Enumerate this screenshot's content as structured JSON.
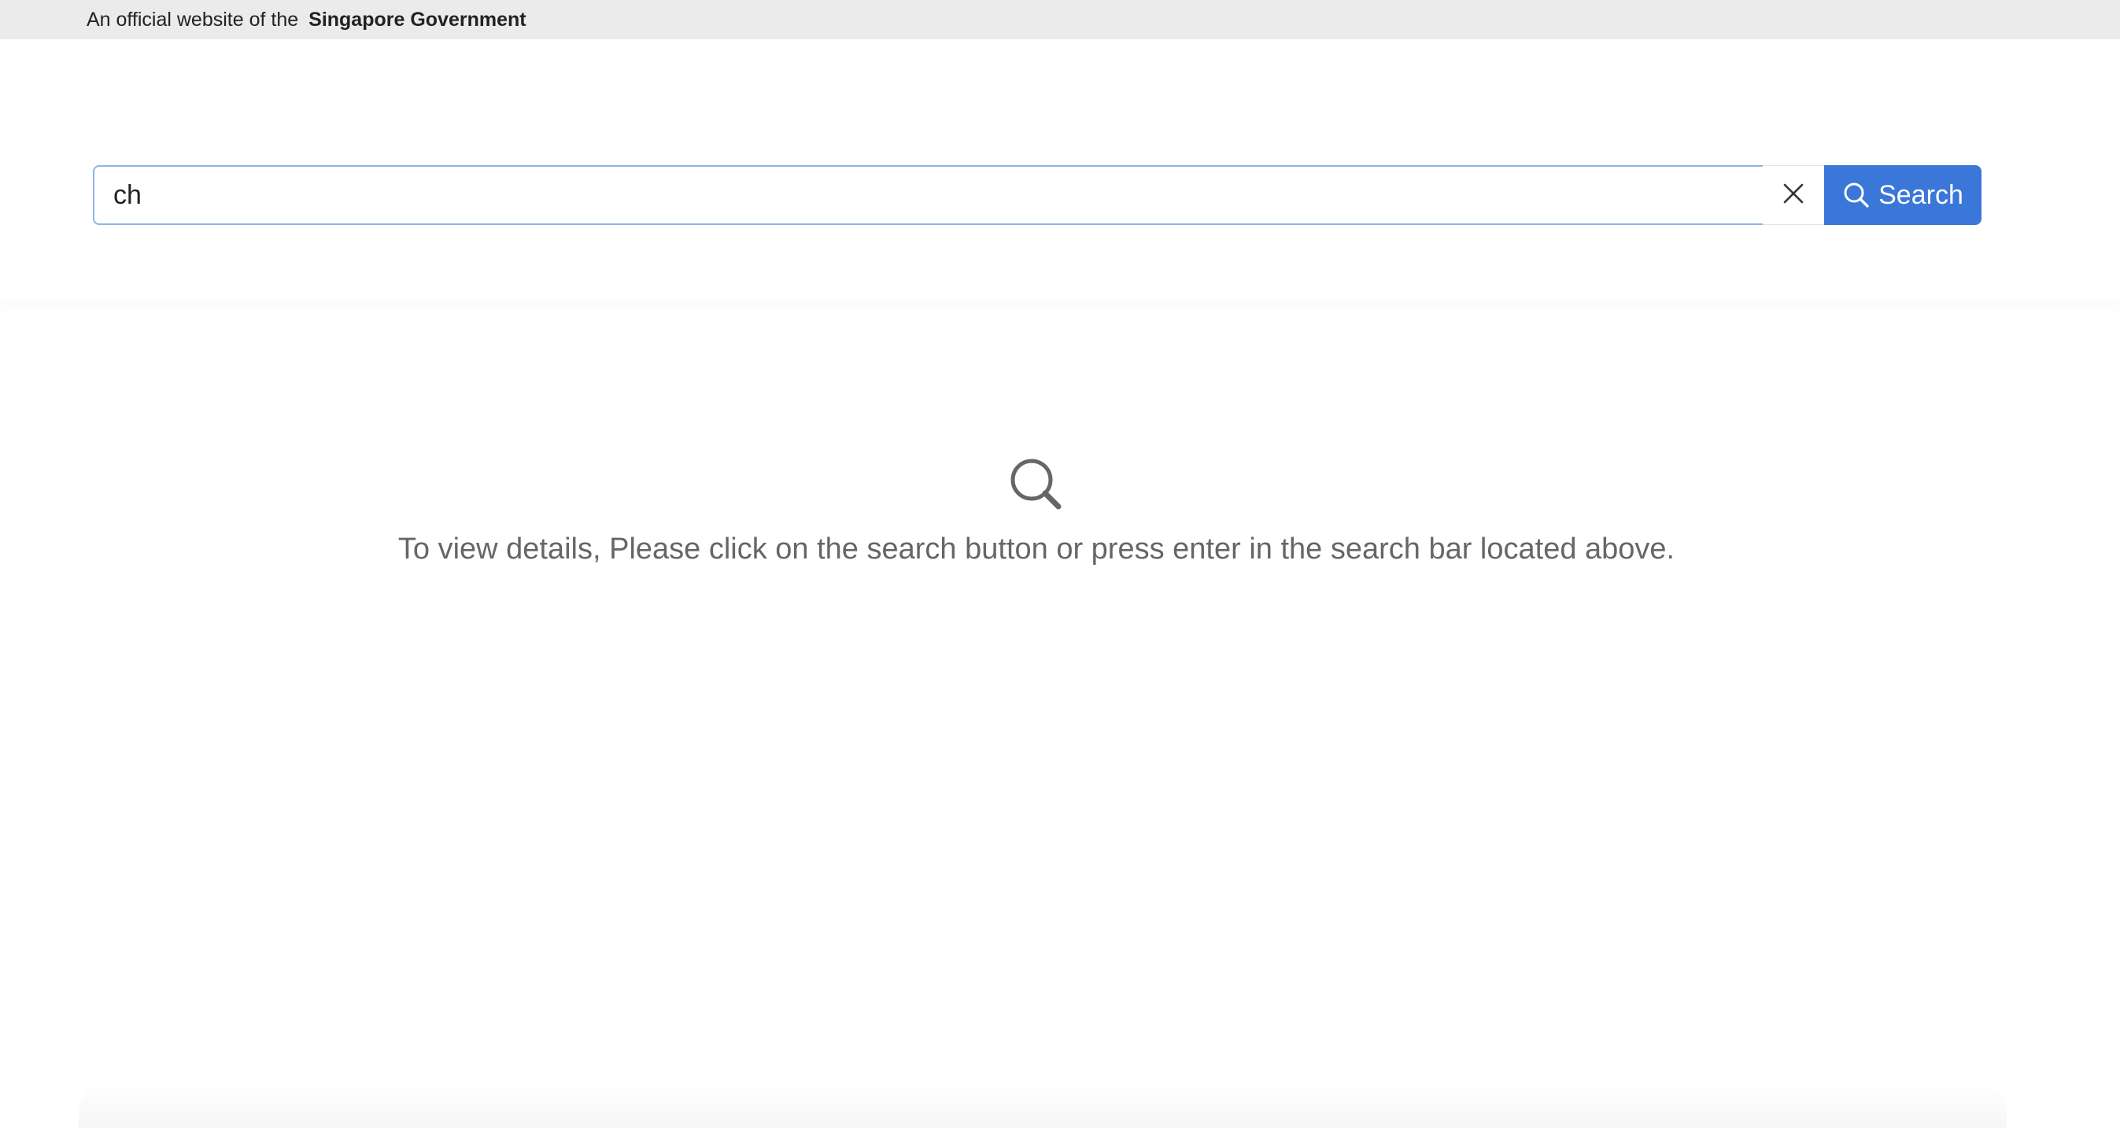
{
  "masthead": {
    "prefix": "An official website of the",
    "government": "Singapore Government"
  },
  "search": {
    "value": "ch",
    "button_label": "Search",
    "clear_icon": "close-icon",
    "button_icon": "search-icon",
    "accent_color": "#3a77d8"
  },
  "empty_state": {
    "icon": "search-icon",
    "message": "To view details, Please click on the search button or press enter in the search bar located above."
  }
}
